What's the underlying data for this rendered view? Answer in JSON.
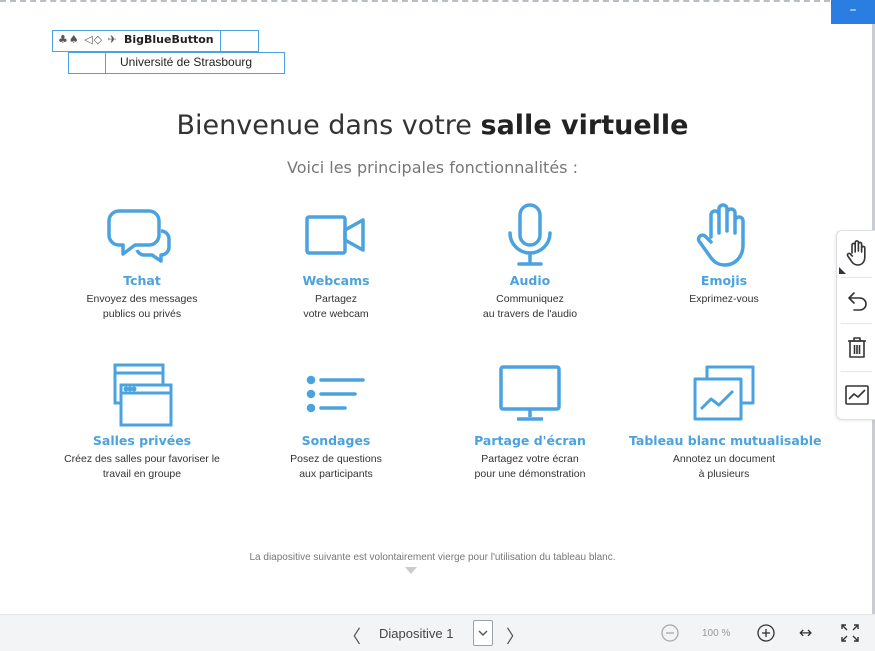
{
  "window": {
    "minimize_label": "–"
  },
  "logo": {
    "icons": "♣♠ ◁◇ ✈",
    "name": "BigBlueButton",
    "university": "Université de Strasbourg"
  },
  "slide": {
    "title_prefix": "Bienvenue dans votre ",
    "title_bold": "salle virtuelle",
    "subtitle": "Voici les principales fonctionnalités :",
    "features": [
      {
        "icon": "chat-icon",
        "name": "Tchat",
        "desc1": "Envoyez des messages",
        "desc2": "publics ou privés"
      },
      {
        "icon": "webcam-icon",
        "name": "Webcams",
        "desc1": "Partagez",
        "desc2": "votre webcam"
      },
      {
        "icon": "microphone-icon",
        "name": "Audio",
        "desc1": "Communiquez",
        "desc2": "au travers de l'audio"
      },
      {
        "icon": "hand-icon",
        "name": "Emojis",
        "desc1": "Exprimez-vous",
        "desc2": ""
      },
      {
        "icon": "windows-icon",
        "name": "Salles privées",
        "desc1": "Créez des salles pour favoriser le",
        "desc2": "travail en groupe"
      },
      {
        "icon": "list-icon",
        "name": "Sondages",
        "desc1": "Posez de questions",
        "desc2": "aux participants"
      },
      {
        "icon": "monitor-icon",
        "name": "Partage d'écran",
        "desc1": "Partagez votre écran",
        "desc2": "pour une démonstration"
      },
      {
        "icon": "whiteboard-icon",
        "name": "Tableau blanc mutualisable",
        "desc1": "Annotez un document",
        "desc2": "à plusieurs"
      }
    ],
    "footnote": "La diapositive suivante est volontairement vierge pour l'utilisation du tableau blanc."
  },
  "toolbar": {
    "tools": [
      "hand-tool-icon",
      "undo-icon",
      "trash-icon",
      "chart-icon"
    ]
  },
  "bottom_bar": {
    "slide_label": "Diapositive 1",
    "zoom": "100 %"
  },
  "colors": {
    "accent": "#4aa3df",
    "button_blue": "#2a7de1"
  }
}
